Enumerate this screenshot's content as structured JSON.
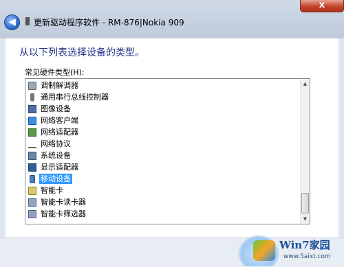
{
  "window": {
    "close_glyph": "x",
    "title": "更新驱动程序软件 - RM-876|Nokia 909"
  },
  "content": {
    "instruction": "从以下列表选择设备的类型。",
    "list_label": "常见硬件类型(H):"
  },
  "hardware_types": [
    {
      "label": "调制解调器",
      "icon": "modem-icon"
    },
    {
      "label": "通用串行总线控制器",
      "icon": "usb-icon"
    },
    {
      "label": "图像设备",
      "icon": "imaging-device-icon"
    },
    {
      "label": "网络客户端",
      "icon": "network-client-icon"
    },
    {
      "label": "网络适配器",
      "icon": "network-adapter-icon"
    },
    {
      "label": "网络协议",
      "icon": "network-protocol-icon"
    },
    {
      "label": "系统设备",
      "icon": "system-device-icon"
    },
    {
      "label": "显示适配器",
      "icon": "display-adapter-icon"
    },
    {
      "label": "移动设备",
      "icon": "mobile-device-icon",
      "selected": true
    },
    {
      "label": "智能卡",
      "icon": "smart-card-icon"
    },
    {
      "label": "智能卡读卡器",
      "icon": "smart-card-reader-icon"
    },
    {
      "label": "智能卡筛选器",
      "icon": "smart-card-filter-icon"
    }
  ],
  "watermark": {
    "title": "Win7家园",
    "url": "www.5aixt.com"
  }
}
